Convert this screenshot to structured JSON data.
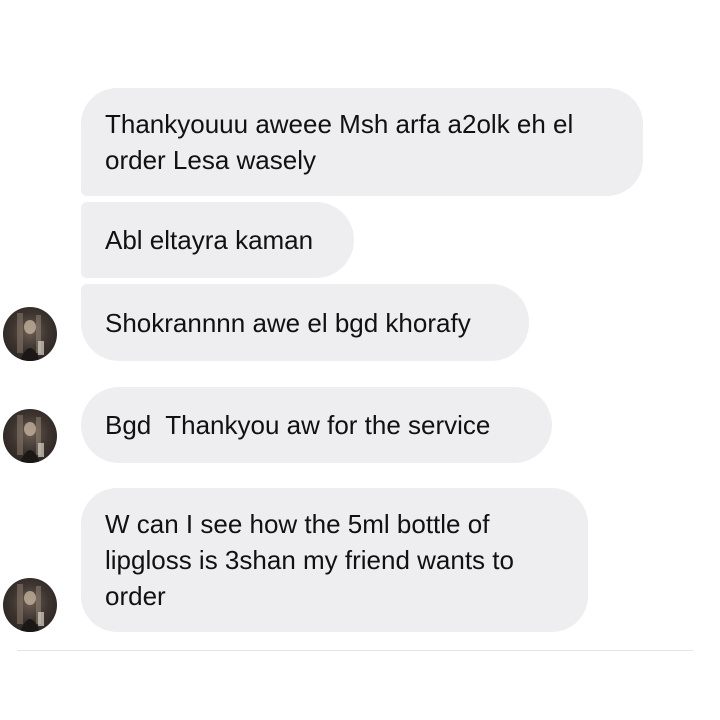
{
  "messages": [
    {
      "lines": [
        "Thankyouuu aweee Msh arfa a2olk eh el",
        "order Lesa wasely"
      ]
    },
    {
      "text": "Abl eltayra kaman"
    },
    {
      "text": "Shokrannnn awe el bgd khorafy"
    },
    {
      "text": "Bgd  Thankyou aw for the service"
    },
    {
      "text": "W can I see how the 5ml bottle of lipgloss is 3shan my friend wants to order"
    }
  ],
  "colors": {
    "bubble": "#eeeef0",
    "text": "#111111",
    "background": "#ffffff"
  },
  "icons": {
    "avatar": "sender-avatar"
  }
}
